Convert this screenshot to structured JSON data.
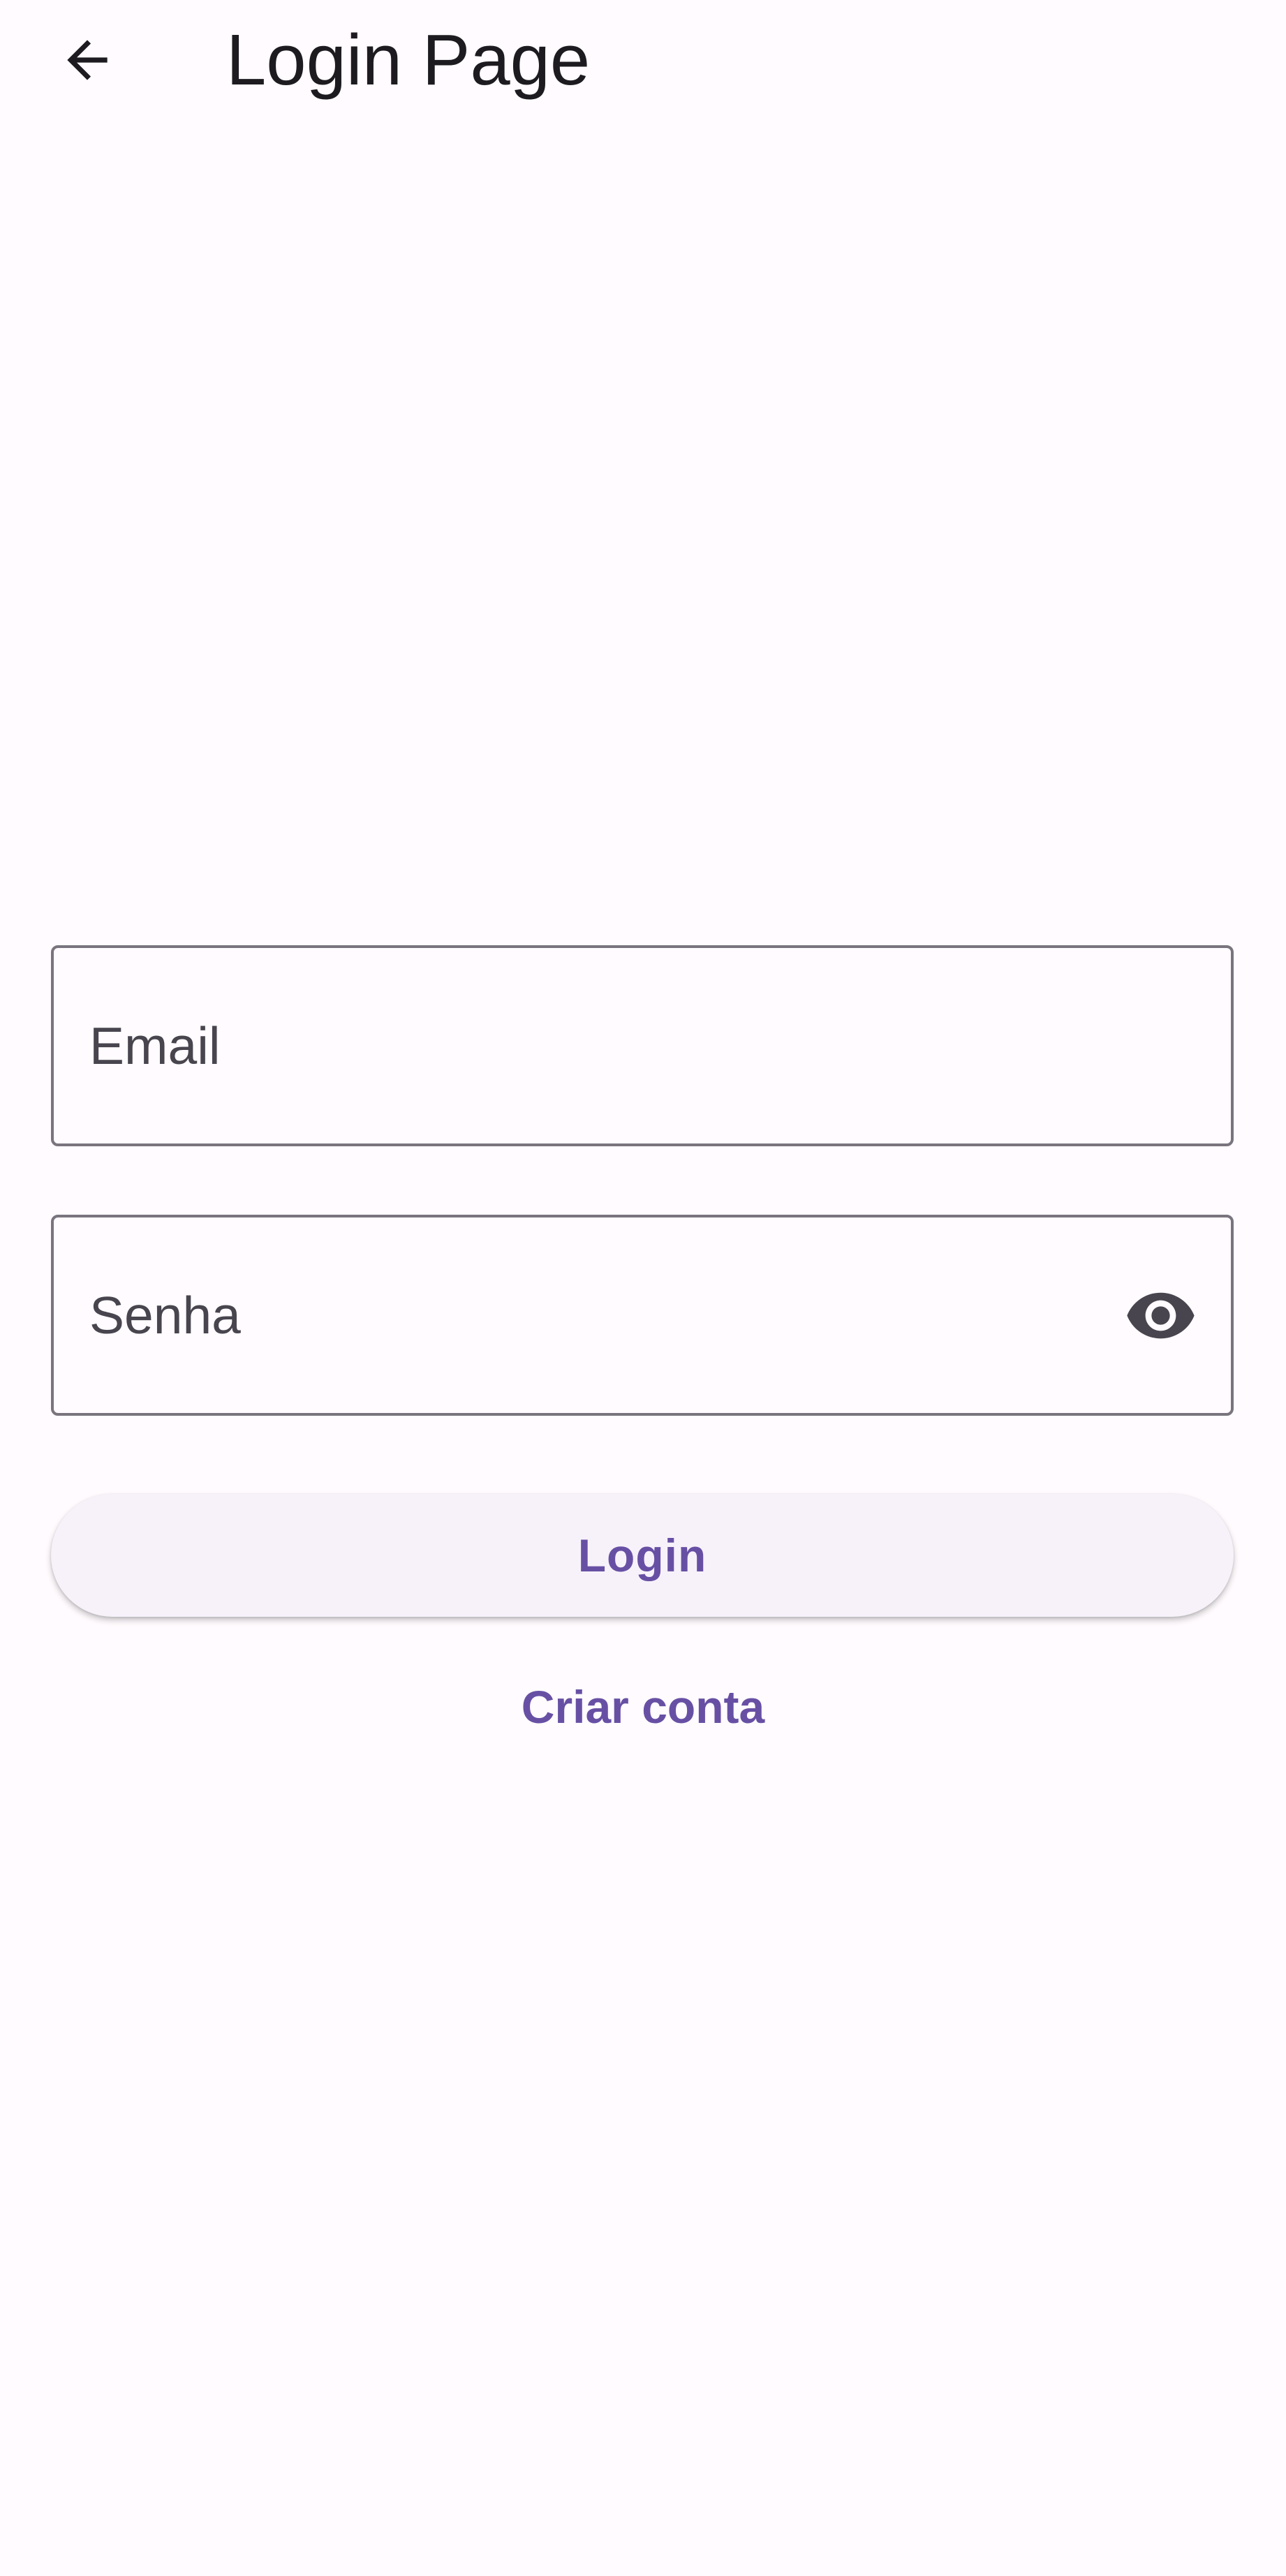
{
  "app_bar": {
    "back_icon": "arrow-back-icon",
    "title": "Login Page"
  },
  "form": {
    "email": {
      "label": "Email",
      "value": ""
    },
    "password": {
      "label": "Senha",
      "value": "",
      "toggle_icon": "eye-icon"
    }
  },
  "actions": {
    "login_label": "Login",
    "create_account_label": "Criar conta"
  },
  "colors": {
    "background": "#fffbfe",
    "primary": "#6750a4",
    "outline": "#79747e",
    "button_surface": "#f7f2fa",
    "on_surface_variant": "#49454f"
  }
}
